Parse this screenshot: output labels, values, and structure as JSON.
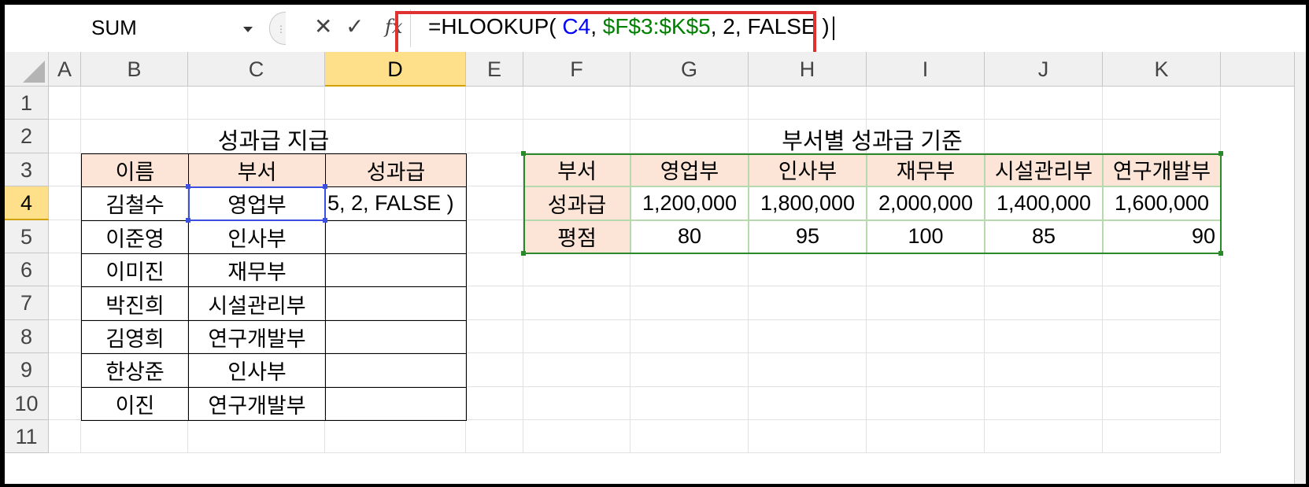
{
  "formula_bar": {
    "name_box": "SUM",
    "formula_prefix": "=HLOOKUP( ",
    "formula_ref1": "C4",
    "formula_sep1": ", ",
    "formula_ref2": "$F$3:$K$5",
    "formula_suffix": ", 2, FALSE )",
    "cancel_icon": "✕",
    "enter_icon": "✓",
    "fx_icon": "fx"
  },
  "columns": [
    "A",
    "B",
    "C",
    "D",
    "E",
    "F",
    "G",
    "H",
    "I",
    "J",
    "K"
  ],
  "rows": [
    "1",
    "2",
    "3",
    "4",
    "5",
    "6",
    "7",
    "8",
    "9",
    "10",
    "11"
  ],
  "left_table": {
    "title": "성과급 지급",
    "headers": [
      "이름",
      "부서",
      "성과급"
    ],
    "rows": [
      {
        "name": "김철수",
        "dept": "영업부",
        "bonus": "5, 2, FALSE )"
      },
      {
        "name": "이준영",
        "dept": "인사부",
        "bonus": ""
      },
      {
        "name": "이미진",
        "dept": "재무부",
        "bonus": ""
      },
      {
        "name": "박진희",
        "dept": "시설관리부",
        "bonus": ""
      },
      {
        "name": "김영희",
        "dept": "연구개발부",
        "bonus": ""
      },
      {
        "name": "한상준",
        "dept": "인사부",
        "bonus": ""
      },
      {
        "name": "이진",
        "dept": "연구개발부",
        "bonus": ""
      }
    ]
  },
  "right_table": {
    "title": "부서별 성과급 기준",
    "header_label": "부서",
    "depts": [
      "영업부",
      "인사부",
      "재무부",
      "시설관리부",
      "연구개발부"
    ],
    "bonus_label": "성과급",
    "bonus": [
      "1,200,000",
      "1,800,000",
      "2,000,000",
      "1,400,000",
      "1,600,000"
    ],
    "score_label": "평점",
    "score": [
      "80",
      "95",
      "100",
      "85",
      "90"
    ]
  },
  "colors": {
    "highlight_box": "#e03131",
    "header_fill": "#fce4d6",
    "active_header": "#ffe08a",
    "ref_blue": "#0000ff",
    "ref_green": "#008000"
  }
}
